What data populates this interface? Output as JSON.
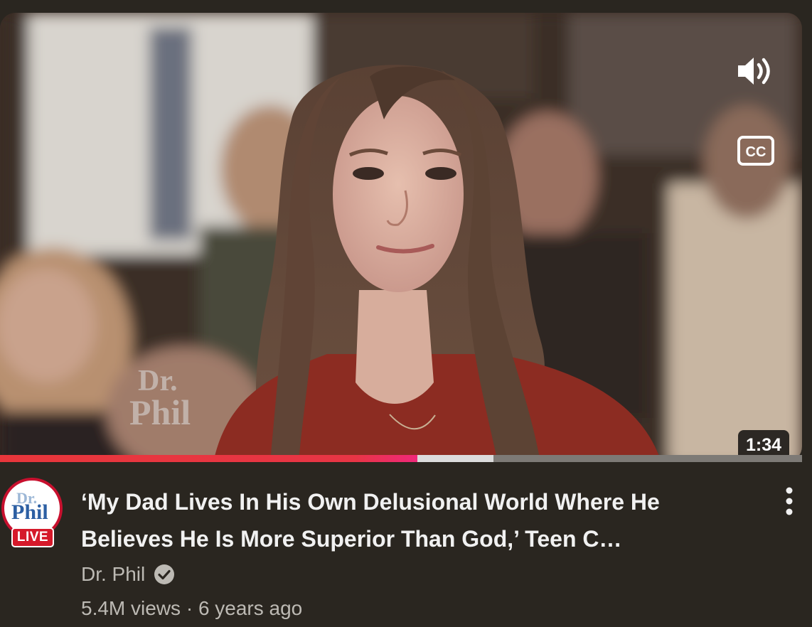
{
  "video": {
    "duration": "1:34",
    "watermark_line1": "Dr.",
    "watermark_line2": "Phil",
    "progress_played": 0.52,
    "progress_buffered": 0.615
  },
  "controls": {
    "volume_icon": "volume-icon",
    "captions_icon": "closed-captions-icon",
    "captions_label": "CC"
  },
  "channel": {
    "avatar_text_line1": "Dr.",
    "avatar_text_line2": "Phil",
    "live_badge": "LIVE",
    "name": "Dr. Phil",
    "verified_icon": "verified-check-icon"
  },
  "details": {
    "title_line1": "‘My Dad Lives In His Own Delusional World Where He",
    "title_line2": "Believes He Is More Superior Than God,’ Teen C…",
    "views": "5.4M views",
    "separator": "·",
    "age": "6 years ago"
  },
  "menu": {
    "icon": "more-vert-icon"
  },
  "colors": {
    "background": "#2a2620",
    "progress_red": "#e8363b",
    "live_red": "#d5192a",
    "text_primary": "#f1f1f1",
    "text_secondary": "#bdbab4"
  }
}
